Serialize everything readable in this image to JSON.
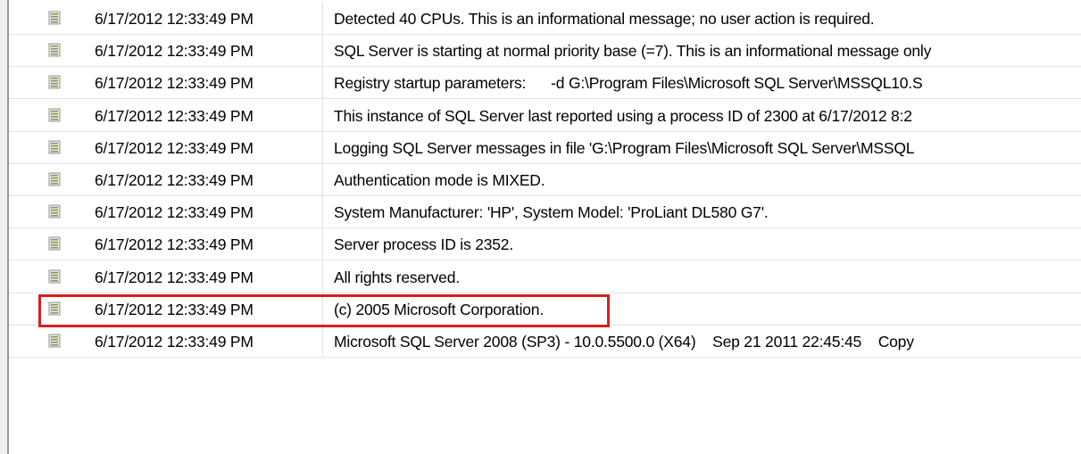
{
  "log_viewer": {
    "columns": [
      "icon",
      "date",
      "message"
    ],
    "rows": [
      {
        "icon": "log-entry-icon",
        "date": "6/17/2012 12:33:49 PM",
        "message": "Detected 40 CPUs. This is an informational message; no user action is required."
      },
      {
        "icon": "log-entry-icon",
        "date": "6/17/2012 12:33:49 PM",
        "message": "SQL Server is starting at normal priority base (=7). This is an informational message only"
      },
      {
        "icon": "log-entry-icon",
        "date": "6/17/2012 12:33:49 PM",
        "message": "Registry startup parameters:      -d G:\\Program Files\\Microsoft SQL Server\\MSSQL10.S"
      },
      {
        "icon": "log-entry-icon",
        "date": "6/17/2012 12:33:49 PM",
        "message": "This instance of SQL Server last reported using a process ID of 2300 at 6/17/2012 8:2"
      },
      {
        "icon": "log-entry-icon",
        "date": "6/17/2012 12:33:49 PM",
        "message": "Logging SQL Server messages in file 'G:\\Program Files\\Microsoft SQL Server\\MSSQL"
      },
      {
        "icon": "log-entry-icon",
        "date": "6/17/2012 12:33:49 PM",
        "message": "Authentication mode is MIXED."
      },
      {
        "icon": "log-entry-icon",
        "date": "6/17/2012 12:33:49 PM",
        "message": "System Manufacturer: 'HP', System Model: 'ProLiant DL580 G7'."
      },
      {
        "icon": "log-entry-icon",
        "date": "6/17/2012 12:33:49 PM",
        "message": "Server process ID is 2352."
      },
      {
        "icon": "log-entry-icon",
        "date": "6/17/2012 12:33:49 PM",
        "message": "All rights reserved."
      },
      {
        "icon": "log-entry-icon",
        "date": "6/17/2012 12:33:49 PM",
        "message": "(c) 2005 Microsoft Corporation."
      },
      {
        "icon": "log-entry-icon",
        "date": "6/17/2012 12:33:49 PM",
        "message": "Microsoft SQL Server 2008 (SP3) - 10.0.5500.0 (X64)    Sep 21 2011 22:45:45    Copy"
      }
    ],
    "highlighted_row_index": 7
  },
  "colors": {
    "highlight_border": "#d92020",
    "icon_fill": "#f4e7a8",
    "icon_border": "#7f9bbf"
  }
}
